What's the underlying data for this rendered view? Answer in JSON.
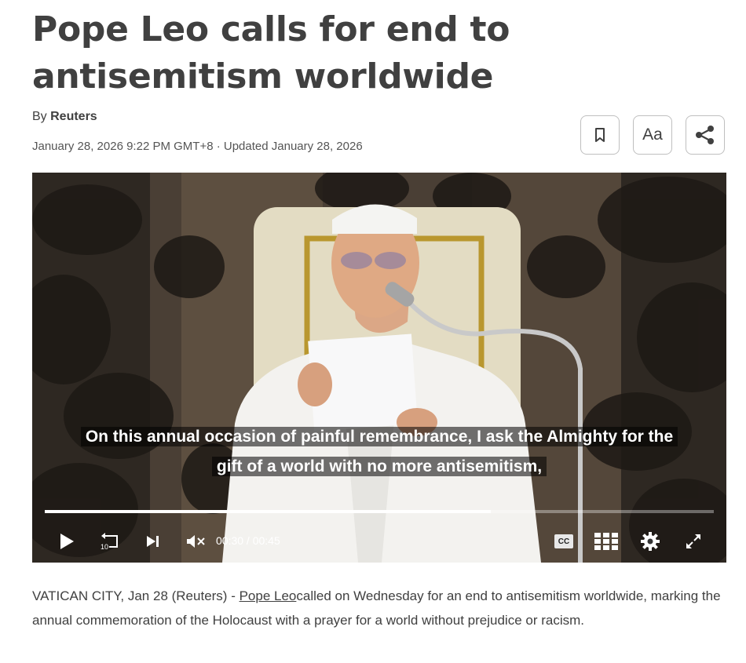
{
  "article": {
    "headline": "Pope Leo calls for end to antisemitism worldwide",
    "by_prefix": "By ",
    "author": "Reuters",
    "dateline": "January 28, 2026 9:22 PM GMT+8 · Updated January 28, 2026",
    "tools": {
      "bookmark_icon": "bookmark-icon",
      "text_size_label": "Aa",
      "share_icon": "share-icon"
    },
    "body": {
      "dateline_prefix": "VATICAN CITY, Jan 28 (Reuters) - ",
      "link_text": "Pope Leo",
      "text_after_link": "called on Wednesday for an end to antisemitism worldwide, marking the annual commemoration of the Holocaust with a prayer for a world without prejudice or racism."
    }
  },
  "video": {
    "caption_line1": "On this annual occasion of painful remembrance, I ask the Almighty for the",
    "caption_line2": "gift of a world with no more antisemitism,",
    "current_time": "00:30",
    "time_separator": " / ",
    "duration": "00:45",
    "progress_fraction": 0.667,
    "rewind_label": "10",
    "cc_label": "CC",
    "controls": [
      "play-icon",
      "rewind-10-icon",
      "skip-next-icon",
      "mute-icon",
      "cc-icon",
      "grid-icon",
      "gear-icon",
      "fullscreen-icon"
    ]
  },
  "colors": {
    "headline": "#404040",
    "video_background": "#2b2621",
    "caption_text": "#ffffff"
  }
}
